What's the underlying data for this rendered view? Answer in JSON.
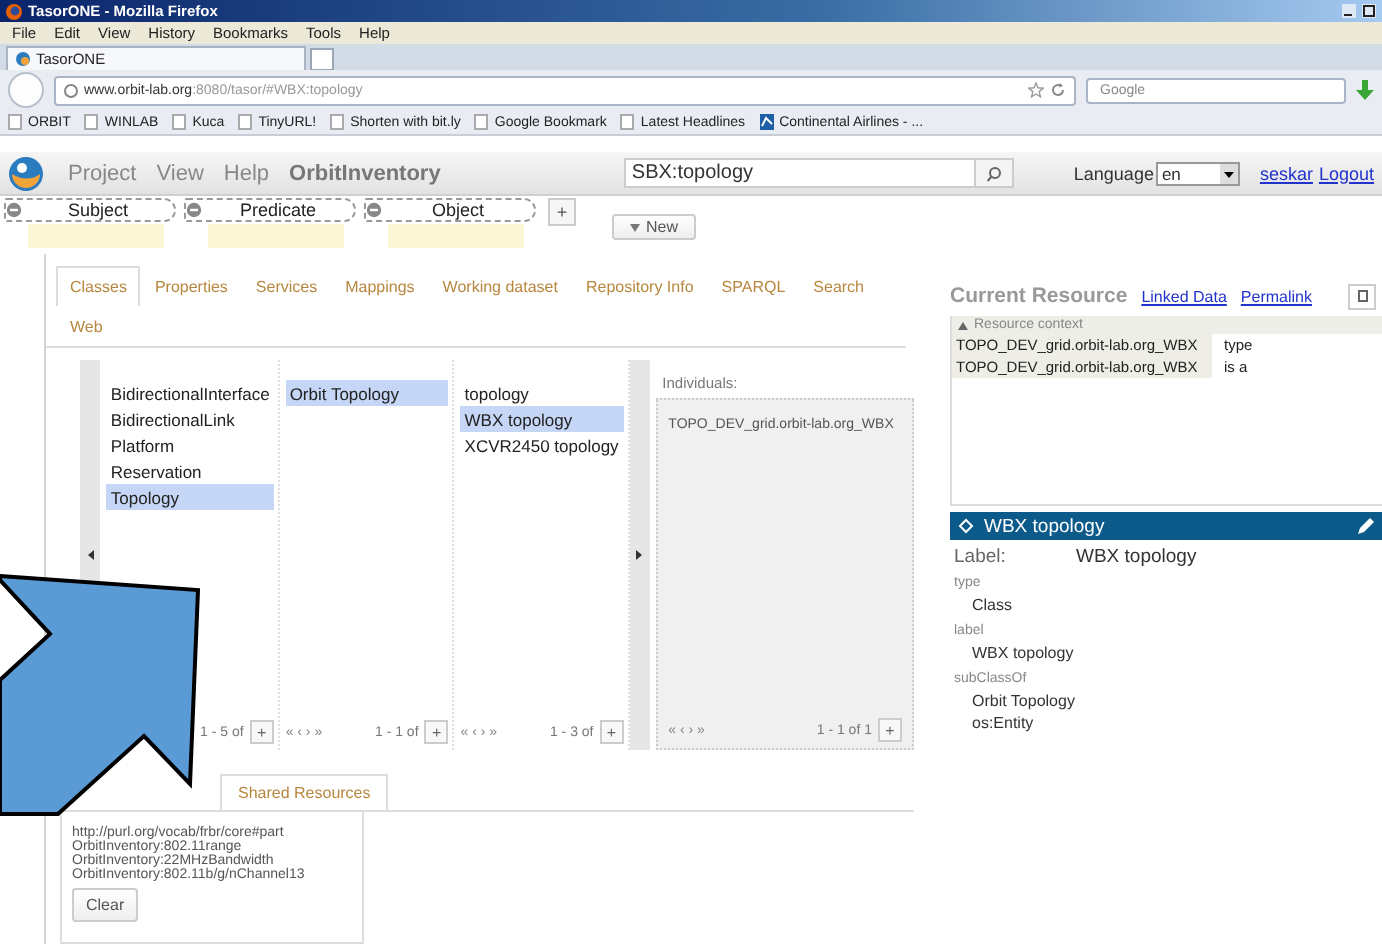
{
  "window": {
    "title": "TasorONE - Mozilla Firefox"
  },
  "menu": [
    "File",
    "Edit",
    "View",
    "History",
    "Bookmarks",
    "Tools",
    "Help"
  ],
  "browser_tabs": [
    {
      "label": "TasorONE",
      "selected": true
    }
  ],
  "address_bar": {
    "host": "www.orbit-lab.org",
    "path": ":8080/tasor/#WBX:topology"
  },
  "search_box": {
    "placeholder": "Google"
  },
  "bookmarks": [
    "ORBIT",
    "WINLAB",
    "Kuca",
    "TinyURL!",
    "Shorten with bit.ly",
    "Google Bookmark",
    "Latest Headlines",
    "Continental Airlines - ..."
  ],
  "app": {
    "menu": [
      "Project",
      "View",
      "Help"
    ],
    "project": "OrbitInventory",
    "search": {
      "value": "SBX:topology"
    },
    "language": {
      "label": "Language",
      "value": "en"
    },
    "user": "seskar",
    "logout": "Logout"
  },
  "triple": {
    "slots": [
      "Subject",
      "Predicate",
      "Object"
    ],
    "add": "+",
    "new": "New"
  },
  "tabs": [
    {
      "label": "Classes",
      "selected": true
    },
    {
      "label": "Properties",
      "selected": false
    },
    {
      "label": "Services",
      "selected": false
    },
    {
      "label": "Mappings",
      "selected": false
    },
    {
      "label": "Working dataset",
      "selected": false
    },
    {
      "label": "Repository Info",
      "selected": false
    },
    {
      "label": "SPARQL",
      "selected": false
    },
    {
      "label": "Search",
      "selected": false
    },
    {
      "label": "Web",
      "selected": false
    }
  ],
  "class_browser": {
    "columns": [
      {
        "items": [
          {
            "label": "BidirectionalInterface",
            "selected": false
          },
          {
            "label": "BidirectionalLink",
            "selected": false
          },
          {
            "label": "Platform",
            "selected": false
          },
          {
            "label": "Reservation",
            "selected": false
          },
          {
            "label": "Topology",
            "selected": true
          }
        ],
        "range": "1 - 5 of",
        "add": "+"
      },
      {
        "items": [
          {
            "label": "Orbit Topology",
            "selected": true
          }
        ],
        "pager": "« ‹ › »",
        "range": "1 - 1 of",
        "add": "+"
      },
      {
        "items": [
          {
            "label": "topology",
            "selected": false
          },
          {
            "label": "WBX topology",
            "selected": true
          },
          {
            "label": "XCVR2450 topology",
            "selected": false
          }
        ],
        "pager": "« ‹ › »",
        "range": "1 - 3 of",
        "add": "+"
      }
    ],
    "individuals": {
      "title": "Individuals:",
      "items": [
        "TOPO_DEV_grid.orbit-lab.org_WBX"
      ],
      "pager": "« ‹ › »",
      "range": "1 - 1 of 1",
      "add": "+"
    }
  },
  "shared": {
    "tab": "Shared Resources",
    "items": [
      "http://purl.org/vocab/frbr/core#part",
      "OrbitInventory:802.11range",
      "OrbitInventory:22MHzBandwidth",
      "OrbitInventory:802.11b/g/nChannel13"
    ],
    "clear": "Clear"
  },
  "resource": {
    "title": "Current Resource",
    "links": [
      "Linked Data",
      "Permalink"
    ],
    "context": {
      "title": "Resource context",
      "rows": [
        {
          "subject": "TOPO_DEV_grid.orbit-lab.org_WBX",
          "predicate": "type"
        },
        {
          "subject": "TOPO_DEV_grid.orbit-lab.org_WBX",
          "predicate": "is a"
        }
      ]
    },
    "header": "WBX topology",
    "label_key": "Label:",
    "label_value": "WBX topology",
    "properties": [
      {
        "name": "type",
        "values": [
          "Class"
        ]
      },
      {
        "name": "label",
        "values": [
          "WBX topology"
        ]
      },
      {
        "name": "subClassOf",
        "values": [
          "Orbit Topology",
          "os:Entity"
        ]
      }
    ]
  }
}
